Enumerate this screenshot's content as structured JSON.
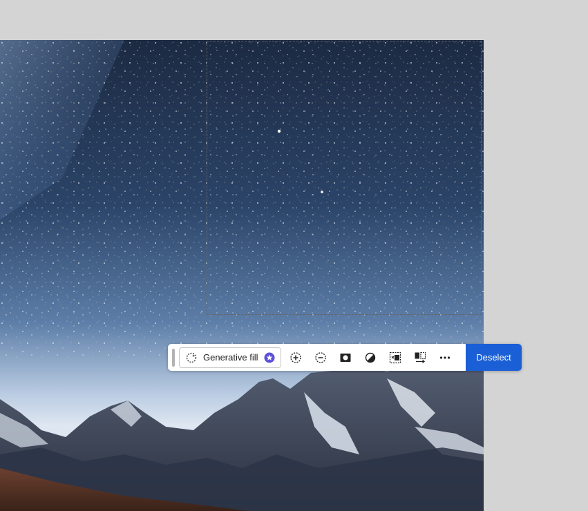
{
  "taskbar": {
    "generative_fill_label": "Generative fill",
    "deselect_label": "Deselect",
    "tools": [
      {
        "name": "add-to-selection",
        "icon": "add-circle-icon"
      },
      {
        "name": "subtract-from-selection",
        "icon": "subtract-circle-icon"
      },
      {
        "name": "create-mask",
        "icon": "mask-icon"
      },
      {
        "name": "adjustment",
        "icon": "half-circle-icon"
      },
      {
        "name": "invert-selection",
        "icon": "invert-selection-icon"
      },
      {
        "name": "transform-selection",
        "icon": "transform-selection-icon"
      },
      {
        "name": "more-options",
        "icon": "ellipsis-icon"
      }
    ]
  },
  "colors": {
    "accent": "#1a5fd6",
    "premium_badge": "#5c4fd9",
    "canvas_bg": "#d4d4d4"
  }
}
